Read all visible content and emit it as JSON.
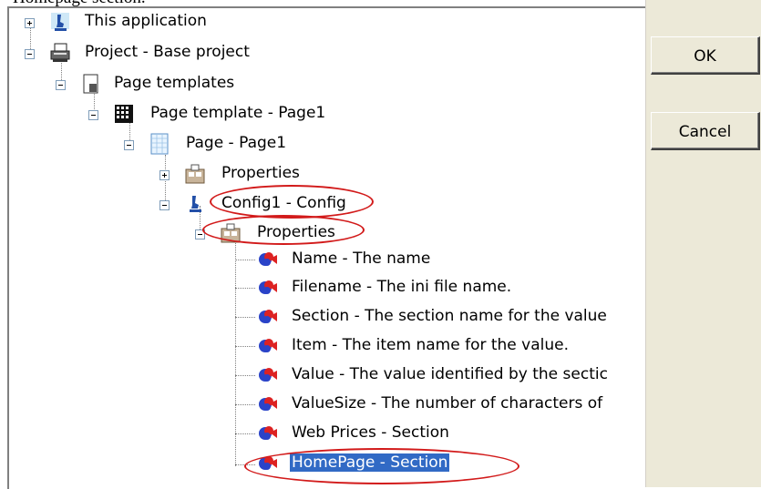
{
  "caption_top": "Homepage section.",
  "buttons": {
    "ok": "OK",
    "cancel": "Cancel"
  },
  "tree": {
    "this_application": "This application",
    "project": "Project - Base project",
    "page_templates": "Page templates",
    "page_template": "Page template - Page1",
    "page": "Page - Page1",
    "page_properties": "Properties",
    "config": "Config1 - Config",
    "config_properties": "Properties",
    "props": [
      "Name - The name",
      "Filename - The ini file name.",
      "Section - The section name for the value",
      "Item - The item name for the value.",
      "Value - The value identified by the sectic",
      "ValueSize - The number of characters of",
      "Web Prices - Section",
      "HomePage - Section"
    ]
  },
  "colors": {
    "selection": "#316ac5",
    "highlight_ellipse": "#d21a1a",
    "dialog_face": "#ece9d8"
  }
}
